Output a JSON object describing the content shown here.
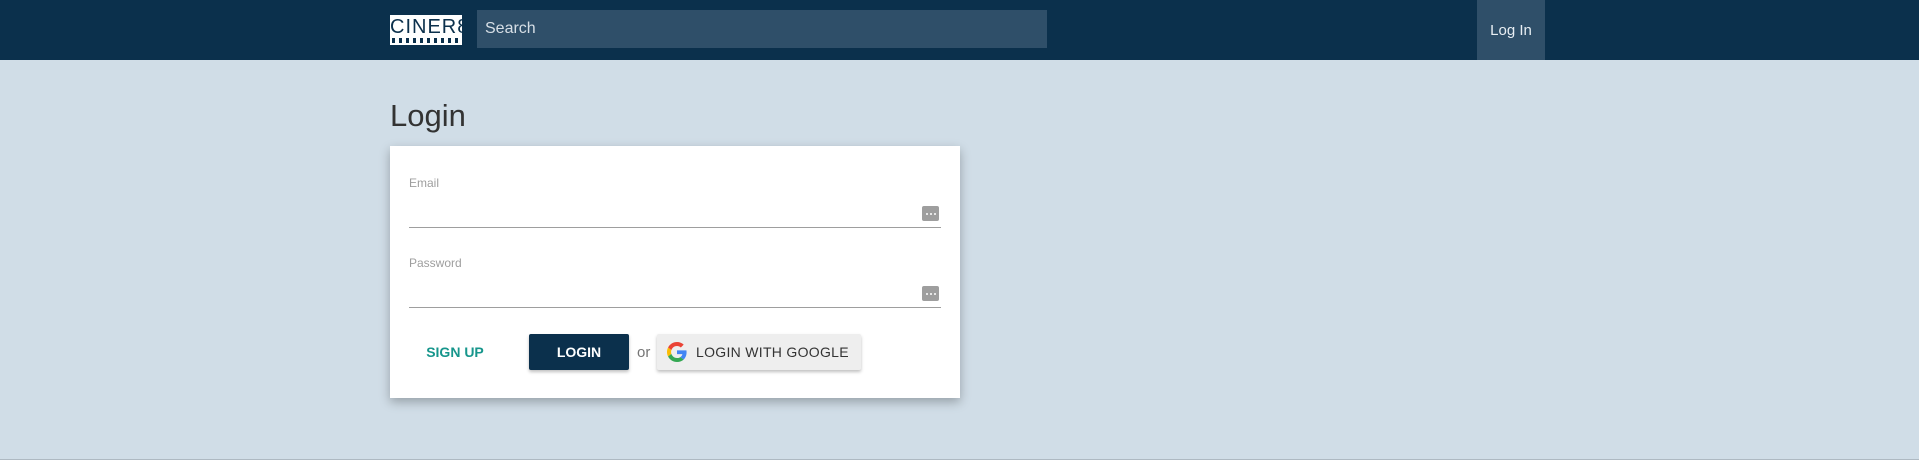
{
  "navbar": {
    "logo_text": "CINER8",
    "search_placeholder": "Search",
    "login_label": "Log In"
  },
  "page": {
    "title": "Login"
  },
  "form": {
    "email_label": "Email",
    "email_value": "",
    "password_label": "Password",
    "password_value": "",
    "signup_label": "SIGN UP",
    "login_label": "LOGIN",
    "or_text": "or",
    "google_label": "LOGIN WITH GOOGLE"
  },
  "colors": {
    "navbar": "#0b304c",
    "background": "#d0dde7",
    "accent": "#17968c"
  }
}
